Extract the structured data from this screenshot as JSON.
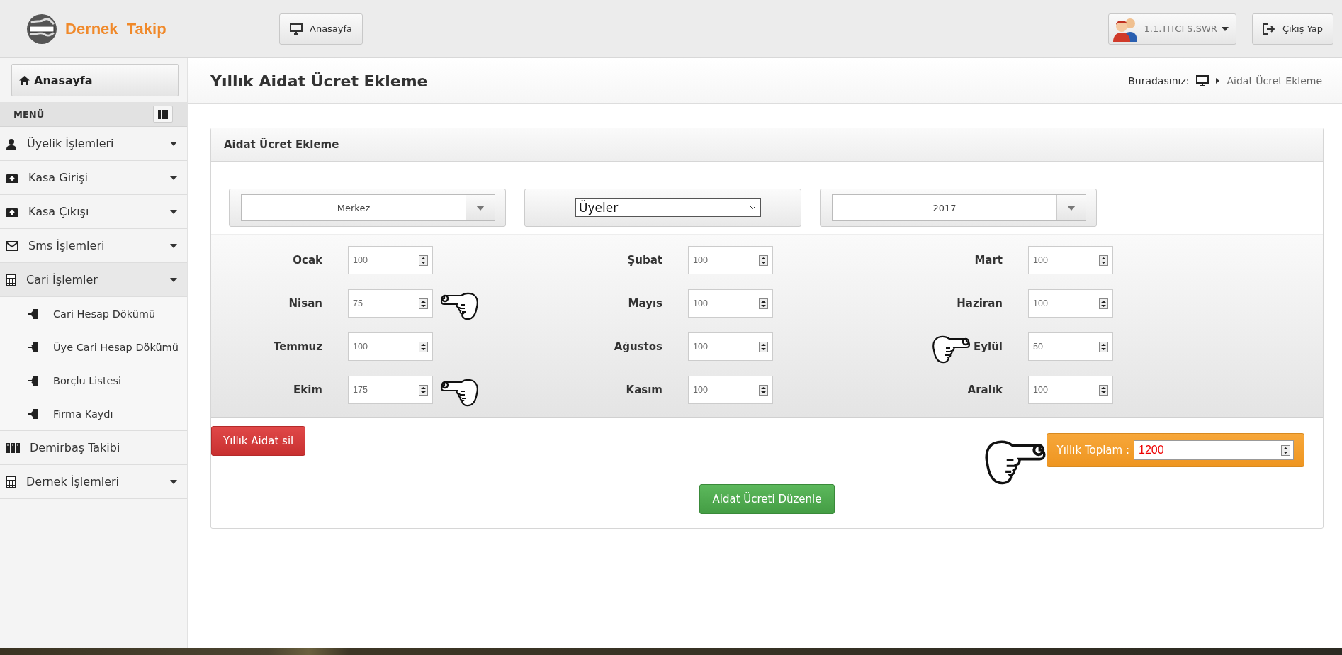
{
  "header": {
    "logo": "Dernek  Takip",
    "home_button": "Anasayfa",
    "user": "1.1.TITCI S.SWR",
    "logout": "Çıkış Yap"
  },
  "sidebar": {
    "home": "Anasayfa",
    "menu_title": "MENÜ",
    "items": [
      {
        "label": "Üyelik İşlemleri",
        "expandable": true
      },
      {
        "label": "Kasa Girişi",
        "expandable": true
      },
      {
        "label": "Kasa Çıkışı",
        "expandable": true
      },
      {
        "label": "Sms İşlemleri",
        "expandable": true
      },
      {
        "label": "Cari İşlemler",
        "expandable": true,
        "expanded": true,
        "children": [
          {
            "label": "Cari Hesap Dökümü"
          },
          {
            "label": "Üye Cari Hesap Dökümü"
          },
          {
            "label": "Borçlu Listesi"
          },
          {
            "label": "Firma Kaydı"
          }
        ]
      },
      {
        "label": "Demirbaş Takibi",
        "expandable": false
      },
      {
        "label": "Dernek İşlemleri",
        "expandable": true
      }
    ]
  },
  "page": {
    "title": "Yıllık Aidat Ücret Ekleme",
    "breadcrumb_label": "Buradasınız:",
    "breadcrumb_current": "Aidat Ücret Ekleme"
  },
  "panel": {
    "title": "Aidat Ücret Ekleme",
    "selects": [
      {
        "kind": "combo",
        "value": "Merkez"
      },
      {
        "kind": "native",
        "value": "Üyeler"
      },
      {
        "kind": "combo",
        "value": "2017"
      }
    ],
    "months": [
      {
        "label": "Ocak",
        "value": "100"
      },
      {
        "label": "Şubat",
        "value": "100"
      },
      {
        "label": "Mart",
        "value": "100"
      },
      {
        "label": "Nisan",
        "value": "75",
        "hand_after": true
      },
      {
        "label": "Mayıs",
        "value": "100"
      },
      {
        "label": "Haziran",
        "value": "100"
      },
      {
        "label": "Temmuz",
        "value": "100"
      },
      {
        "label": "Ağustos",
        "value": "100"
      },
      {
        "label": "Eylül",
        "value": "50",
        "hand_before": true
      },
      {
        "label": "Ekim",
        "value": "175",
        "hand_after": true
      },
      {
        "label": "Kasım",
        "value": "100"
      },
      {
        "label": "Aralık",
        "value": "100"
      }
    ],
    "delete_button": "Yıllık Aidat sil",
    "total_label": "Yıllık Toplam :",
    "total_value": "1200",
    "total_pointer": true,
    "save_button": "Aidat Ücreti Düzenle"
  }
}
